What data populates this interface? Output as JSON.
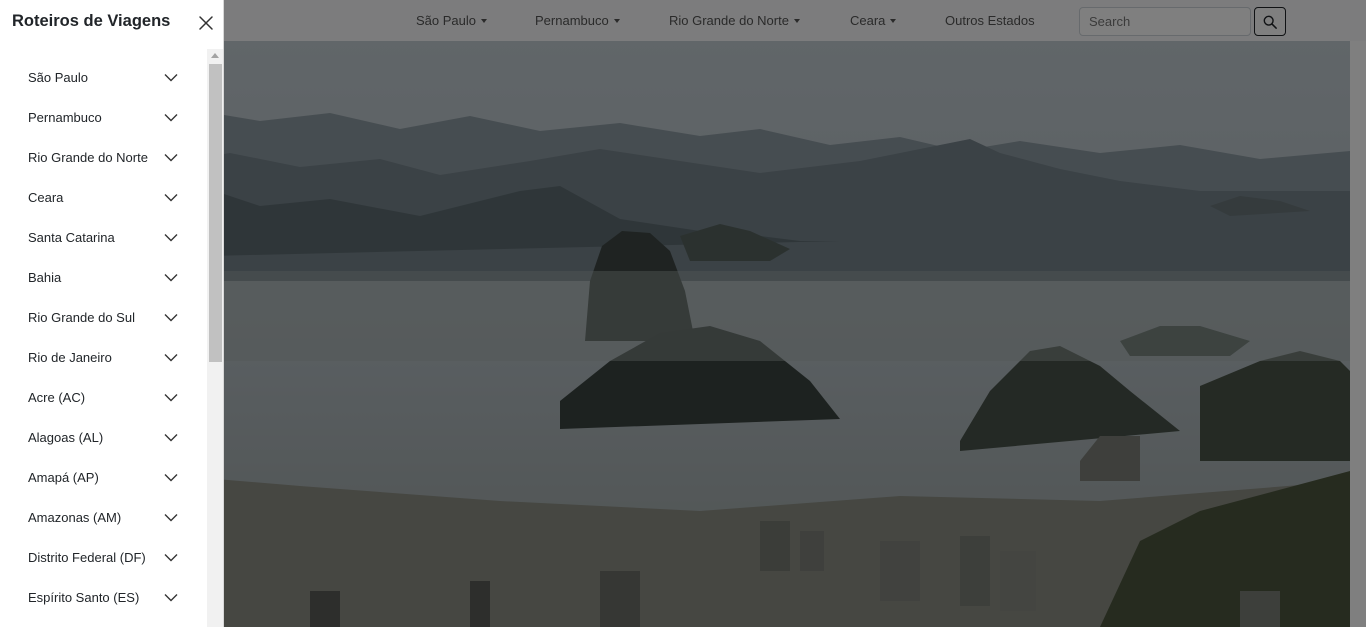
{
  "navbar": {
    "links": [
      {
        "label": "São Paulo",
        "dropdown": true
      },
      {
        "label": "Pernambuco",
        "dropdown": true
      },
      {
        "label": "Rio Grande do Norte",
        "dropdown": true
      },
      {
        "label": "Ceara",
        "dropdown": true
      },
      {
        "label": "Outros Estados",
        "dropdown": false
      }
    ],
    "search": {
      "placeholder": "Search",
      "icon": "search-icon"
    }
  },
  "offcanvas": {
    "title": "Roteiros de Viagens",
    "close_icon": "close-icon",
    "item_icon": "chevron-down-icon",
    "items": [
      "São Paulo",
      "Pernambuco",
      "Rio Grande do Norte",
      "Ceara",
      "Santa Catarina",
      "Bahia",
      "Rio Grande do Sul",
      "Rio de Janeiro",
      "Acre (AC)",
      "Alagoas (AL)",
      "Amapá (AP)",
      "Amazonas (AM)",
      "Distrito Federal (DF)",
      "Espírito Santo (ES)"
    ]
  },
  "colors": {
    "backdrop": "#000000",
    "text": "#212529",
    "nav_text": "#555555"
  }
}
